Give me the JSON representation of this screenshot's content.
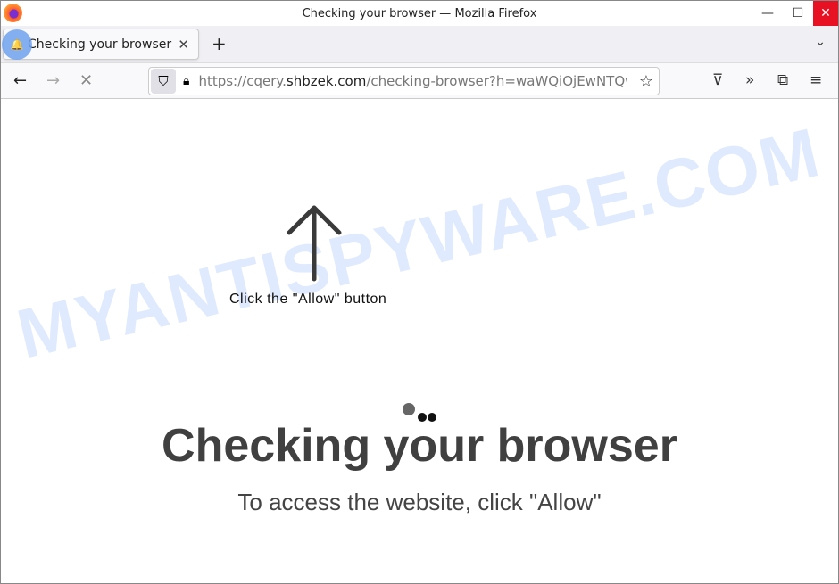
{
  "window": {
    "title": "Checking your browser — Mozilla Firefox"
  },
  "tab": {
    "label": "Checking your browser",
    "icon": "notification-bell-icon"
  },
  "url": {
    "scheme": "https://cqery.",
    "domain": "shbzek.com",
    "path": "/checking-browser?h=waWQiOjEwNTQwM"
  },
  "page": {
    "hint": "Click the \"Allow\" button",
    "heading": "Checking your browser",
    "subtitle": "To access the website, click \"Allow\"",
    "watermark": "MYANTISPYWARE.COM"
  },
  "colors": {
    "close": "#e81123",
    "heading": "#404040",
    "watermark": "#508cff"
  }
}
